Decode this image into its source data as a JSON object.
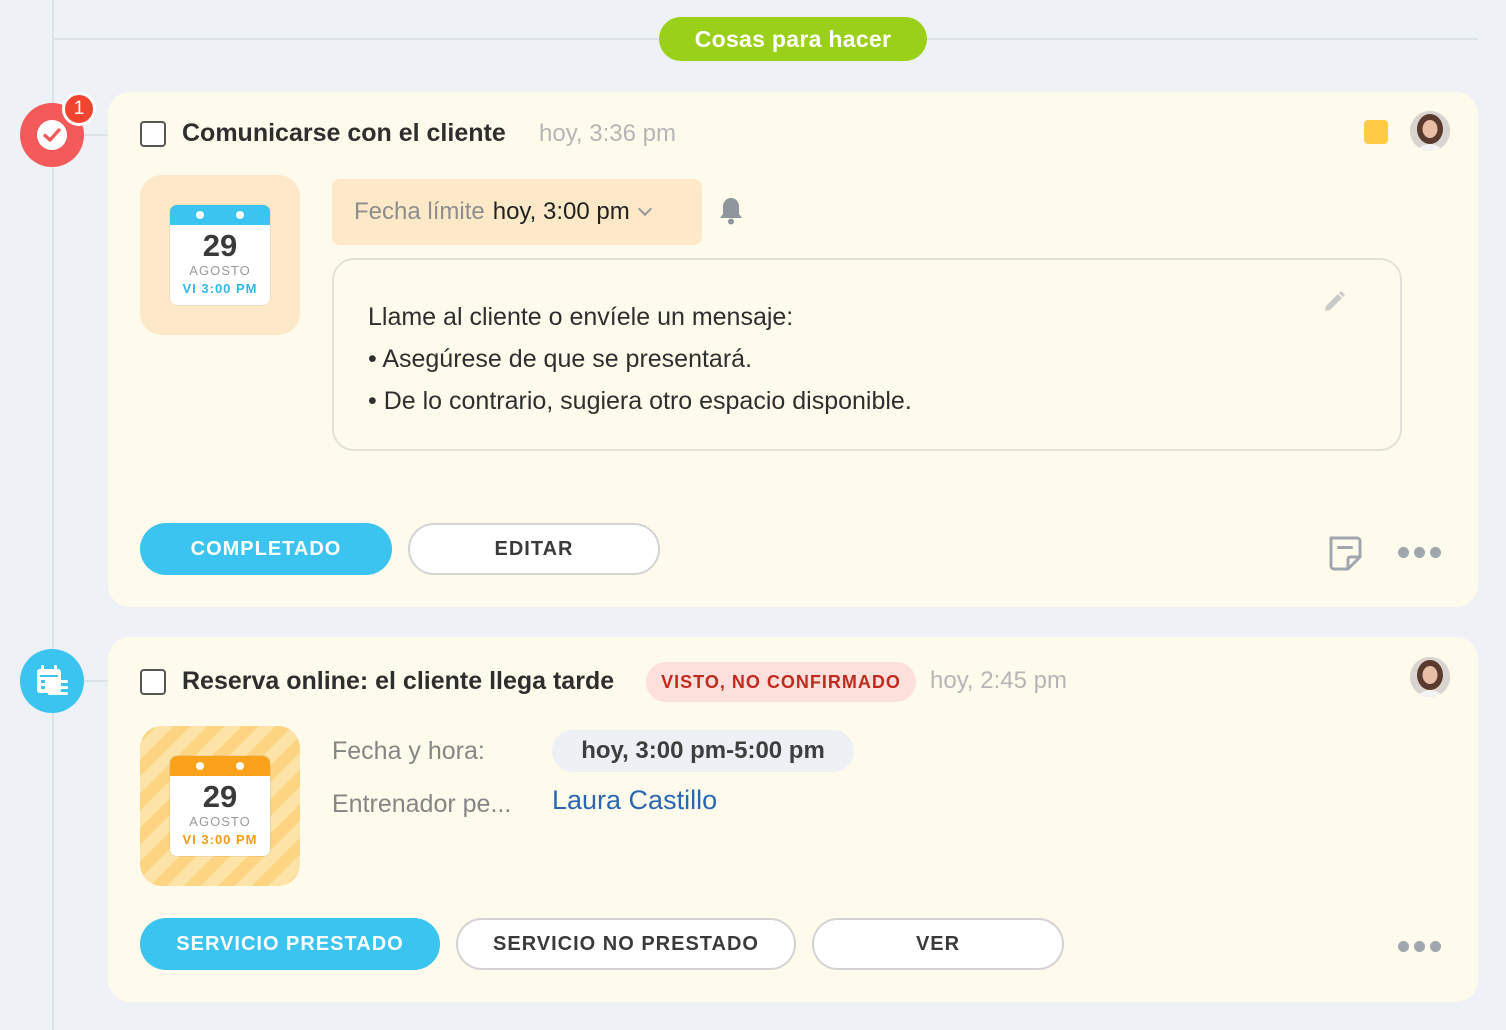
{
  "section": {
    "label": "Cosas para hacer"
  },
  "task_card": {
    "badge_count": "1",
    "title": "Comunicarse con el cliente",
    "time": "hoy, 3:36 pm",
    "calendar": {
      "day": "29",
      "month": "AGOSTO",
      "time": "VI 3:00 PM"
    },
    "deadline_label": "Fecha límite",
    "deadline_value": "hoy, 3:00 pm",
    "note_lines": [
      "Llame al cliente o envíele un mensaje:",
      "• Asegúrese de que se presentará.",
      "• De lo contrario, sugiera otro espacio disponible."
    ],
    "complete_label": "COMPLETADO",
    "edit_label": "EDITAR",
    "color_tag": "#ffcb47"
  },
  "booking_card": {
    "title": "Reserva online: el cliente llega tarde",
    "status": "VISTO, NO CONFIRMADO",
    "time": "hoy, 2:45 pm",
    "calendar": {
      "day": "29",
      "month": "AGOSTO",
      "time": "VI 3:00 PM"
    },
    "date_label": "Fecha y hora:",
    "date_value": "hoy, 3:00 pm-5:00 pm",
    "trainer_label": "Entrenador pe...",
    "trainer_value": "Laura Castillo",
    "service_done_label": "SERVICIO PRESTADO",
    "service_not_done_label": "SERVICIO NO PRESTADO",
    "view_label": "VER"
  },
  "colors": {
    "accent": "#3cc4f0",
    "section_pill": "#9bd01a",
    "task_icon": "#f55a5a",
    "card_bg": "#fffbec"
  }
}
